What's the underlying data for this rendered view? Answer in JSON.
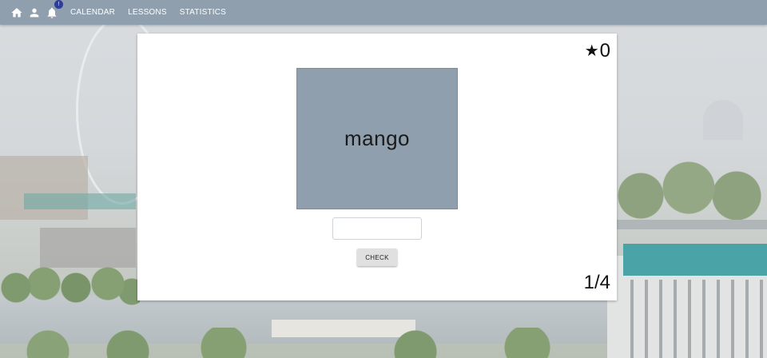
{
  "nav": {
    "icons": [
      "home-icon",
      "person-icon",
      "bell-icon"
    ],
    "notification_count": "!",
    "links": [
      {
        "label": "CALENDAR"
      },
      {
        "label": "LESSONS"
      },
      {
        "label": "STATISTICS"
      }
    ]
  },
  "lesson": {
    "score": "0",
    "word": "mango",
    "answer_value": "",
    "answer_placeholder": "",
    "check_label": "CHECK",
    "progress": "1/4"
  },
  "colors": {
    "topbar": "#8f9fae",
    "tile": "#8f9fae",
    "badge": "#2f3d9a",
    "card": "#ffffff"
  }
}
